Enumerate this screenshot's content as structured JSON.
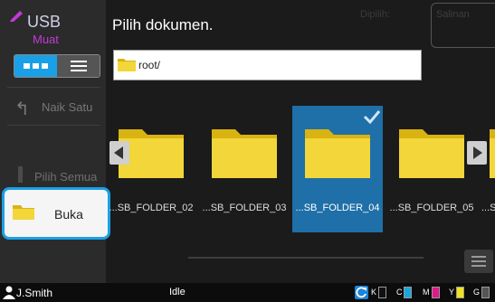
{
  "brand": {
    "title": "USB",
    "subtitle": "Muat",
    "icon": "usb-pencil-icon"
  },
  "sidebar": {
    "up_label": "Naik Satu",
    "select_all_label": "Pilih Semua",
    "open_label": "Buka"
  },
  "header": {
    "title": "Pilih dokumen.",
    "selected_label": "Dipilih:",
    "copies_label": "Salinan"
  },
  "path": {
    "value": "root/"
  },
  "folders": [
    {
      "name": "...SB_FOLDER_02",
      "selected": false
    },
    {
      "name": "...SB_FOLDER_03",
      "selected": false
    },
    {
      "name": "...SB_FOLDER_04",
      "selected": true
    },
    {
      "name": "...SB_FOLDER_05",
      "selected": false
    },
    {
      "name": "...S",
      "selected": false
    }
  ],
  "statusbar": {
    "user": "J.Smith",
    "status": "Idle",
    "inks": [
      {
        "letter": "K",
        "color": "#111111"
      },
      {
        "letter": "C",
        "color": "#19a7e0"
      },
      {
        "letter": "M",
        "color": "#e0198a"
      },
      {
        "letter": "Y",
        "color": "#f2e21a"
      },
      {
        "letter": "G",
        "color": "#555555"
      }
    ]
  },
  "colors": {
    "accent": "#1aa0e6",
    "selected_tile": "#1f6fa8",
    "folder": "#f2d63a",
    "brand_sub": "#c23ad7"
  }
}
